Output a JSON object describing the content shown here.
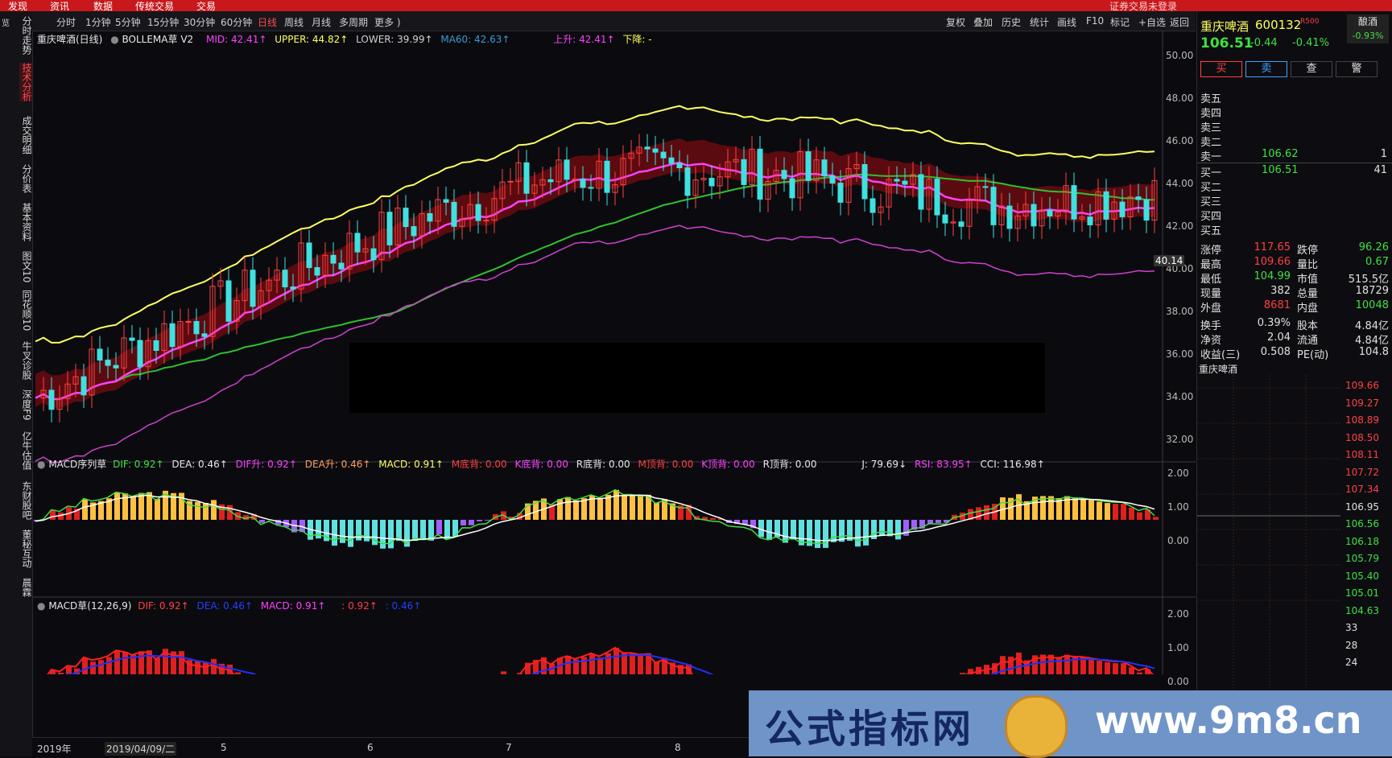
{
  "top_menu": [
    "发现",
    "资讯",
    "数据",
    "传统交易",
    "交易"
  ],
  "top_right_status": "证券交易未登录",
  "left_tabs": [
    "分时走势",
    "技术分析",
    "成交明细",
    "分价表",
    "基本资料",
    "图文10",
    "同花顺10",
    "牛叉诊股",
    "深度F9",
    "亿牛估值",
    "东财股吧",
    "董秘互动",
    "晨霖"
  ],
  "left_edge": [
    "览"
  ],
  "toolbar": {
    "periods": [
      "分时",
      "1分钟",
      "5分钟",
      "15分钟",
      "30分钟",
      "60分钟",
      "日线",
      "周线",
      "月线",
      "多周期",
      "更多 )"
    ],
    "active_period": "日线",
    "actions": [
      "复权",
      "叠加",
      "历史",
      "统计",
      "画线",
      "F10",
      "标记",
      "+自选",
      "返回"
    ]
  },
  "main_header": {
    "title": "重庆啤酒(日线)",
    "indicator": "BOLLEMA草 V2",
    "mid": "MID: 42.41↑",
    "upper": "UPPER: 44.82↑",
    "lower": "LOWER: 39.99↑",
    "ma60": "MA60: 42.63↑",
    "up": "上升: 42.41↑",
    "down": "下降: -"
  },
  "main_axis": [
    "50.00",
    "48.00",
    "46.00",
    "44.00",
    "42.00",
    "40.00",
    "38.00",
    "36.00",
    "34.00",
    "32.00"
  ],
  "price_marker": "40.14",
  "macd_seq_header": {
    "name": "MACD序列草",
    "dif": "DIF: 0.92↑",
    "dea": "DEA: 0.46↑",
    "dif_up": "DIF升: 0.92↑",
    "dea_up": "DEA升: 0.46↑",
    "macd": "MACD: 0.91↑",
    "m_bottom": "M底背: 0.00",
    "k_bottom": "K底背: 0.00",
    "r_bottom": "R底背: 0.00",
    "m_top": "M顶背: 0.00",
    "k_top": "K顶背: 0.00",
    "r_top": "R顶背: 0.00",
    "j": "J: 79.69↓",
    "rsi": "RSI: 83.95↑",
    "cci": "CCI: 116.98↑"
  },
  "macd_seq_axis": [
    "2.00",
    "1.00",
    "0.00"
  ],
  "macd_header": {
    "name": "MACD草(12,26,9)",
    "dif": "DIF: 0.92↑",
    "dea": "DEA: 0.46↑",
    "macd": "MACD: 0.91↑",
    "extra1": ": 0.92↑",
    "extra2": ": 0.46↑"
  },
  "macd_axis": [
    "2.00",
    "1.00",
    "0.00"
  ],
  "dates": [
    "2019年",
    "2019/04/09/二",
    "5",
    "6",
    "7",
    "8"
  ],
  "right_panel": {
    "stock_name": "重庆啤酒",
    "code": "600132",
    "tag": "R500",
    "sector": "酿酒",
    "sector_change": "-0.93%",
    "price": "106.51",
    "change": "-0.44",
    "change_pct": "-0.41%",
    "buttons": [
      "买",
      "卖",
      "查",
      "警"
    ],
    "asks": [
      {
        "label": "卖五",
        "price": "",
        "vol": ""
      },
      {
        "label": "卖四",
        "price": "",
        "vol": ""
      },
      {
        "label": "卖三",
        "price": "",
        "vol": ""
      },
      {
        "label": "卖二",
        "price": "",
        "vol": ""
      },
      {
        "label": "卖一",
        "price": "106.62",
        "vol": "1"
      }
    ],
    "bids": [
      {
        "label": "买一",
        "price": "106.51",
        "vol": "41"
      },
      {
        "label": "买二",
        "price": "",
        "vol": ""
      },
      {
        "label": "买三",
        "price": "",
        "vol": ""
      },
      {
        "label": "买四",
        "price": "",
        "vol": ""
      },
      {
        "label": "买五",
        "price": "",
        "vol": ""
      }
    ],
    "stats": [
      {
        "l1": "涨停",
        "v1": "117.65",
        "c1": "#ff4040",
        "l2": "跌停",
        "v2": "96.26",
        "c2": "#40e040"
      },
      {
        "l1": "最高",
        "v1": "109.66",
        "c1": "#ff4040",
        "l2": "量比",
        "v2": "0.67",
        "c2": "#40e040"
      },
      {
        "l1": "最低",
        "v1": "104.99",
        "c1": "#40e040",
        "l2": "市值",
        "v2": "515.5亿",
        "c2": "#e0e0e0"
      },
      {
        "l1": "现量",
        "v1": "382",
        "c1": "#e0e0e0",
        "l2": "总量",
        "v2": "18729",
        "c2": "#e0e0e0"
      },
      {
        "l1": "外盘",
        "v1": "8681",
        "c1": "#ff4040",
        "l2": "内盘",
        "v2": "10048",
        "c2": "#40e040"
      },
      {
        "l1": "换手",
        "v1": "0.39%",
        "c1": "#e0e0e0",
        "l2": "股本",
        "v2": "4.84亿",
        "c2": "#e0e0e0"
      },
      {
        "l1": "净资",
        "v1": "2.04",
        "c1": "#e0e0e0",
        "l2": "流通",
        "v2": "4.84亿",
        "c2": "#e0e0e0"
      },
      {
        "l1": "收益(三)",
        "v1": "0.508",
        "c1": "#e0e0e0",
        "l2": "PE(动)",
        "v2": "104.8",
        "c2": "#e0e0e0"
      }
    ],
    "mini_title": "重庆啤酒",
    "mini_axis": [
      {
        "v": "109.66",
        "c": "#ff4040"
      },
      {
        "v": "109.27",
        "c": "#ff4040"
      },
      {
        "v": "108.89",
        "c": "#ff4040"
      },
      {
        "v": "108.50",
        "c": "#ff4040"
      },
      {
        "v": "108.11",
        "c": "#ff4040"
      },
      {
        "v": "107.72",
        "c": "#ff4040"
      },
      {
        "v": "107.34",
        "c": "#ff4040"
      },
      {
        "v": "106.95",
        "c": "#e0e0e0"
      },
      {
        "v": "106.56",
        "c": "#40e040"
      },
      {
        "v": "106.18",
        "c": "#40e040"
      },
      {
        "v": "105.79",
        "c": "#40e040"
      },
      {
        "v": "105.40",
        "c": "#40e040"
      },
      {
        "v": "105.01",
        "c": "#40e040"
      },
      {
        "v": "104.63",
        "c": "#40e040"
      },
      {
        "v": "33",
        "c": "#e0e0e0"
      },
      {
        "v": "28",
        "c": "#e0e0e0"
      },
      {
        "v": "24",
        "c": "#e0e0e0"
      }
    ]
  },
  "watermark": {
    "name": "公式指标网",
    "url": "www.9m8.cn"
  },
  "colors": {
    "up": "#ff4040",
    "down": "#40e0e0",
    "upper": "#ffff60",
    "mid": "#ff40ff",
    "ma60": "#30c030",
    "lower": "#d040d0"
  }
}
